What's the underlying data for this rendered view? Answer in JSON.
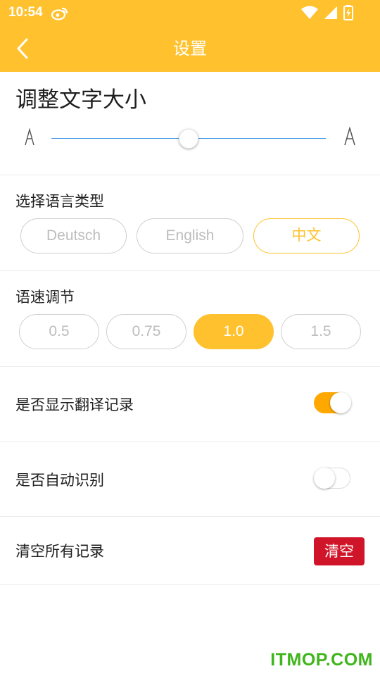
{
  "status_bar": {
    "time": "10:54",
    "icons": [
      "weibo-icon",
      "wifi-icon",
      "signal-icon",
      "battery-charging-icon"
    ]
  },
  "header": {
    "title": "设置",
    "back_icon": "chevron-left-icon",
    "color": "#FFC22E"
  },
  "font_size": {
    "title": "调整文字大小",
    "small_glyph": "A",
    "large_glyph": "A",
    "slider_value": 0.5
  },
  "language": {
    "title": "选择语言类型",
    "options": [
      "Deutsch",
      "English",
      "中文"
    ],
    "selected": "中文"
  },
  "speed": {
    "title": "语速调节",
    "options": [
      "0.5",
      "0.75",
      "1.0",
      "1.5"
    ],
    "selected": "1.0"
  },
  "show_history": {
    "label": "是否显示翻译记录",
    "enabled": true
  },
  "auto_detect": {
    "label": "是否自动识别",
    "enabled": false
  },
  "clear_history": {
    "label": "清空所有记录",
    "button_label": "清空",
    "button_color": "#D0152A"
  },
  "watermark": "ITMOP.COM"
}
